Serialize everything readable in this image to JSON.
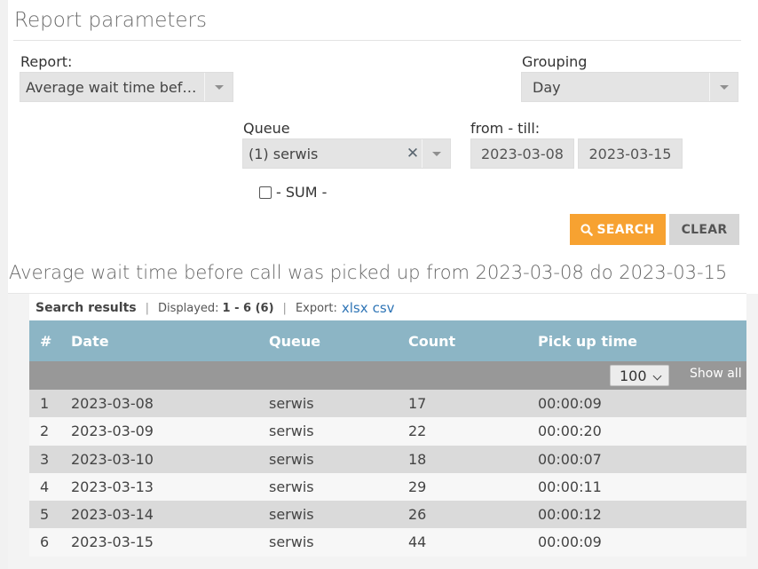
{
  "panel": {
    "title": "Report parameters",
    "report_label": "Report:",
    "report_value": "Average wait time before call was picked up",
    "grouping_label": "Grouping",
    "grouping_value": "Day",
    "queue_label": "Queue",
    "queue_value": "(1) serwis",
    "date_label": "from - till:",
    "date_from": "2023-03-08",
    "date_till": "2023-03-15",
    "sum_label": "- SUM -",
    "sum_checked": false,
    "search_button": "SEARCH",
    "clear_button": "CLEAR"
  },
  "results": {
    "heading": "Average wait time before call was picked up from 2023-03-08 do 2023-03-15",
    "search_results_label": "Search results",
    "displayed_label": "Displayed:",
    "displayed_value": "1 - 6 (6)",
    "export_label": "Export:",
    "export_xlsx": "xlsx",
    "export_csv": "csv",
    "columns": [
      "#",
      "Date",
      "Queue",
      "Count",
      "Pick up time"
    ],
    "page_size": "100",
    "show_all": "Show all",
    "rows": [
      {
        "num": "1",
        "date": "2023-03-08",
        "queue": "serwis",
        "count": "17",
        "pick": "00:00:09"
      },
      {
        "num": "2",
        "date": "2023-03-09",
        "queue": "serwis",
        "count": "22",
        "pick": "00:00:20"
      },
      {
        "num": "3",
        "date": "2023-03-10",
        "queue": "serwis",
        "count": "18",
        "pick": "00:00:07"
      },
      {
        "num": "4",
        "date": "2023-03-13",
        "queue": "serwis",
        "count": "29",
        "pick": "00:00:11"
      },
      {
        "num": "5",
        "date": "2023-03-14",
        "queue": "serwis",
        "count": "26",
        "pick": "00:00:12"
      },
      {
        "num": "6",
        "date": "2023-03-15",
        "queue": "serwis",
        "count": "44",
        "pick": "00:00:09"
      }
    ]
  },
  "colors": {
    "accent_search": "#f7a231",
    "table_header": "#8cb5c5",
    "link": "#2f75b6"
  }
}
